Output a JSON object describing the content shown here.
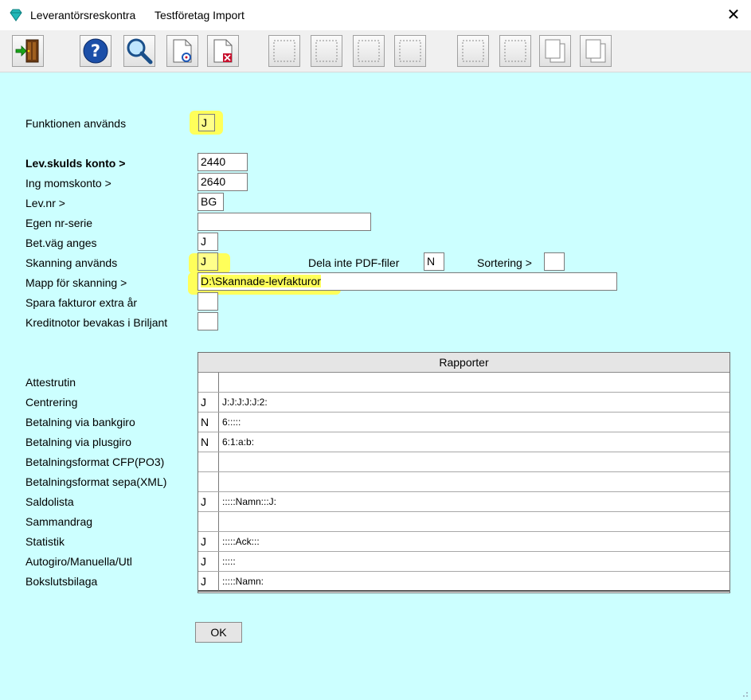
{
  "window": {
    "app_title": "Leverantörsreskontra",
    "company": "Testföretag Import",
    "close_glyph": "✕"
  },
  "toolbar": {
    "buttons": [
      {
        "icon": "exit-door-icon",
        "enabled": true
      },
      {
        "icon": "help-icon",
        "enabled": true
      },
      {
        "icon": "search-magnifier-icon",
        "enabled": true
      },
      {
        "icon": "refresh-document-icon",
        "enabled": true
      },
      {
        "icon": "delete-document-icon",
        "enabled": true
      },
      {
        "icon": "empty-slot-icon",
        "enabled": false
      },
      {
        "icon": "empty-slot-icon",
        "enabled": false
      },
      {
        "icon": "empty-slot-icon",
        "enabled": false
      },
      {
        "icon": "empty-slot-icon",
        "enabled": false
      },
      {
        "icon": "empty-slot-icon",
        "enabled": false
      },
      {
        "icon": "empty-slot-icon",
        "enabled": false
      },
      {
        "icon": "copy-pages-icon",
        "enabled": false
      },
      {
        "icon": "copy-pages-icon",
        "enabled": false
      }
    ]
  },
  "colors": {
    "background": "#ccffff",
    "highlight": "#ffff5a",
    "header_grey": "#e5e5e5"
  },
  "form": {
    "funktionen_label": "Funktionen används",
    "funktionen_value": "J",
    "levskulds_label": "Lev.skulds konto >",
    "levskulds_value": "2440",
    "momskonto_label": "Ing momskonto >",
    "momskonto_value": "2640",
    "levnr_label": "Lev.nr >",
    "levnr_value": "BG",
    "egen_nr_label": "Egen nr-serie",
    "egen_nr_value": "",
    "betvag_label": "Bet.väg anges",
    "betvag_value": "J",
    "skanning_label": "Skanning används",
    "skanning_value": "J",
    "dela_pdf_label": "Dela inte PDF-filer",
    "dela_pdf_value": "N",
    "sortering_label": "Sortering >",
    "sortering_value": "",
    "mapp_label": "Mapp för skanning >",
    "mapp_value": "D:\\Skannade-levfakturor",
    "spara_label": "Spara fakturor extra år",
    "spara_value": "",
    "kreditnotor_label": "Kreditnotor bevakas i Briljant",
    "kreditnotor_value": ""
  },
  "rapporter": {
    "header": "Rapporter",
    "rows": [
      {
        "label": "Attestrutin",
        "flag": "",
        "value": ""
      },
      {
        "label": "Centrering",
        "flag": "J",
        "value": "J:J:J:J:J:2:"
      },
      {
        "label": "Betalning via bankgiro",
        "flag": "N",
        "value": "6:::::"
      },
      {
        "label": "Betalning via plusgiro",
        "flag": "N",
        "value": "6:1:a:b:"
      },
      {
        "label": "Betalningsformat CFP(PO3)",
        "flag": "",
        "value": ""
      },
      {
        "label": "Betalningsformat sepa(XML)",
        "flag": "",
        "value": ""
      },
      {
        "label": "Saldolista",
        "flag": "J",
        "value": ":::::Namn:::J:"
      },
      {
        "label": "Sammandrag",
        "flag": "",
        "value": ""
      },
      {
        "label": "Statistik",
        "flag": "J",
        "value": ":::::Ack:::"
      },
      {
        "label": "Autogiro/Manuella/Utl",
        "flag": "J",
        "value": ":::::"
      },
      {
        "label": "Bokslutsbilaga",
        "flag": "J",
        "value": ":::::Namn:"
      }
    ]
  },
  "ok_label": "OK"
}
